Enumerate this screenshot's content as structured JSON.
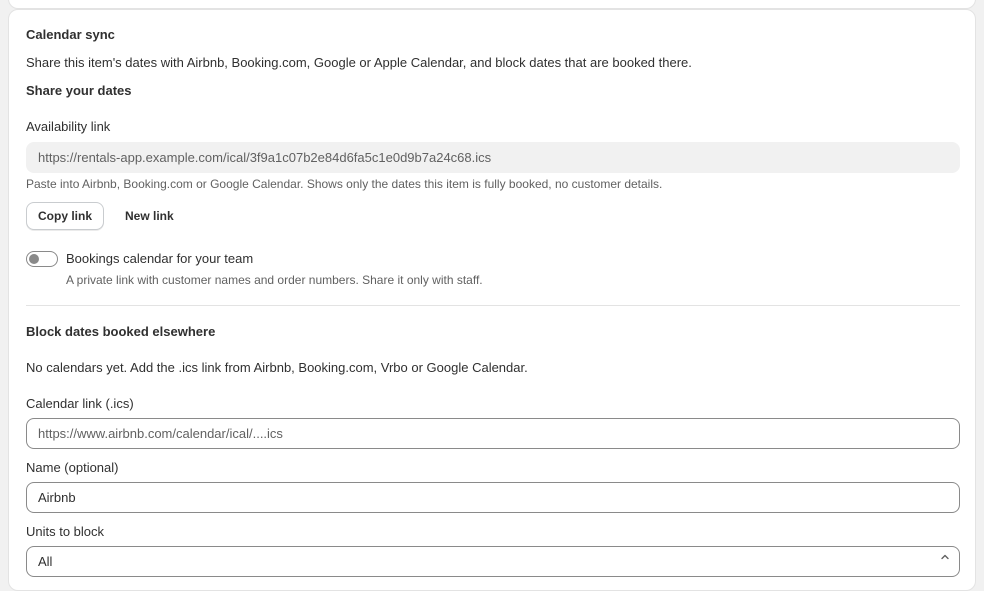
{
  "section": {
    "title": "Calendar sync",
    "description": "Share this item's dates with Airbnb, Booking.com, Google or Apple Calendar, and block dates that are booked there."
  },
  "share": {
    "heading": "Share your dates",
    "availability_label": "Availability link",
    "availability_url": "https://rentals-app.example.com/ical/3f9a1c07b2e84d6fa5c1e0d9b7a24c68.ics",
    "help_text": "Paste into Airbnb, Booking.com or Google Calendar. Shows only the dates this item is fully booked, no customer details.",
    "copy_label": "Copy link",
    "new_label": "New link"
  },
  "team": {
    "toggle_label": "Bookings calendar for your team",
    "toggle_on": false,
    "description": "A private link with customer names and order numbers. Share it only with staff."
  },
  "block": {
    "heading": "Block dates booked elsewhere",
    "empty_text": "No calendars yet. Add the .ics link from Airbnb, Booking.com, Vrbo or Google Calendar.",
    "calendar_link_label": "Calendar link (.ics)",
    "calendar_link_placeholder": "https://www.airbnb.com/calendar/ical/....ics",
    "name_label": "Name (optional)",
    "name_value": "Airbnb",
    "units_label": "Units to block",
    "units_value": "All"
  },
  "icons": {
    "select": "chevron-up-icon"
  },
  "colors": {
    "text": "#303030",
    "subdued": "#616161",
    "border": "#8a8a8a",
    "card": "#ffffff",
    "page": "#f1f1f1"
  }
}
